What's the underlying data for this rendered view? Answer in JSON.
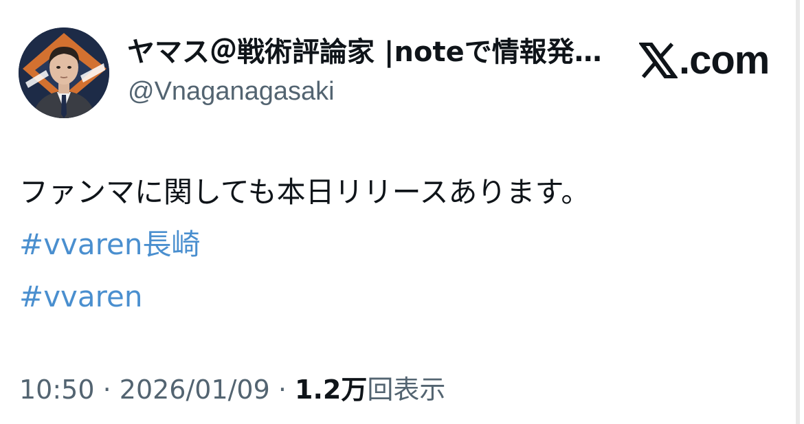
{
  "author": {
    "display_name": "ヤマス＠戦術評論家 |noteで情報発…",
    "handle": "@Vnaganagasaki"
  },
  "brand": {
    "icon": "x-logo-icon",
    "domain": ".com"
  },
  "tweet": {
    "text": "ファンマに関しても本日リリースあります。",
    "hashtags": [
      "#vvaren長崎",
      "#vvaren"
    ],
    "time": "10:50",
    "separator": " · ",
    "date": "2026/01/09",
    "views_count": "1.2万",
    "views_label": "回表示"
  },
  "colors": {
    "hashtag": "#4a8fcf",
    "secondary_text": "#536471",
    "primary_text": "#0f1419"
  }
}
